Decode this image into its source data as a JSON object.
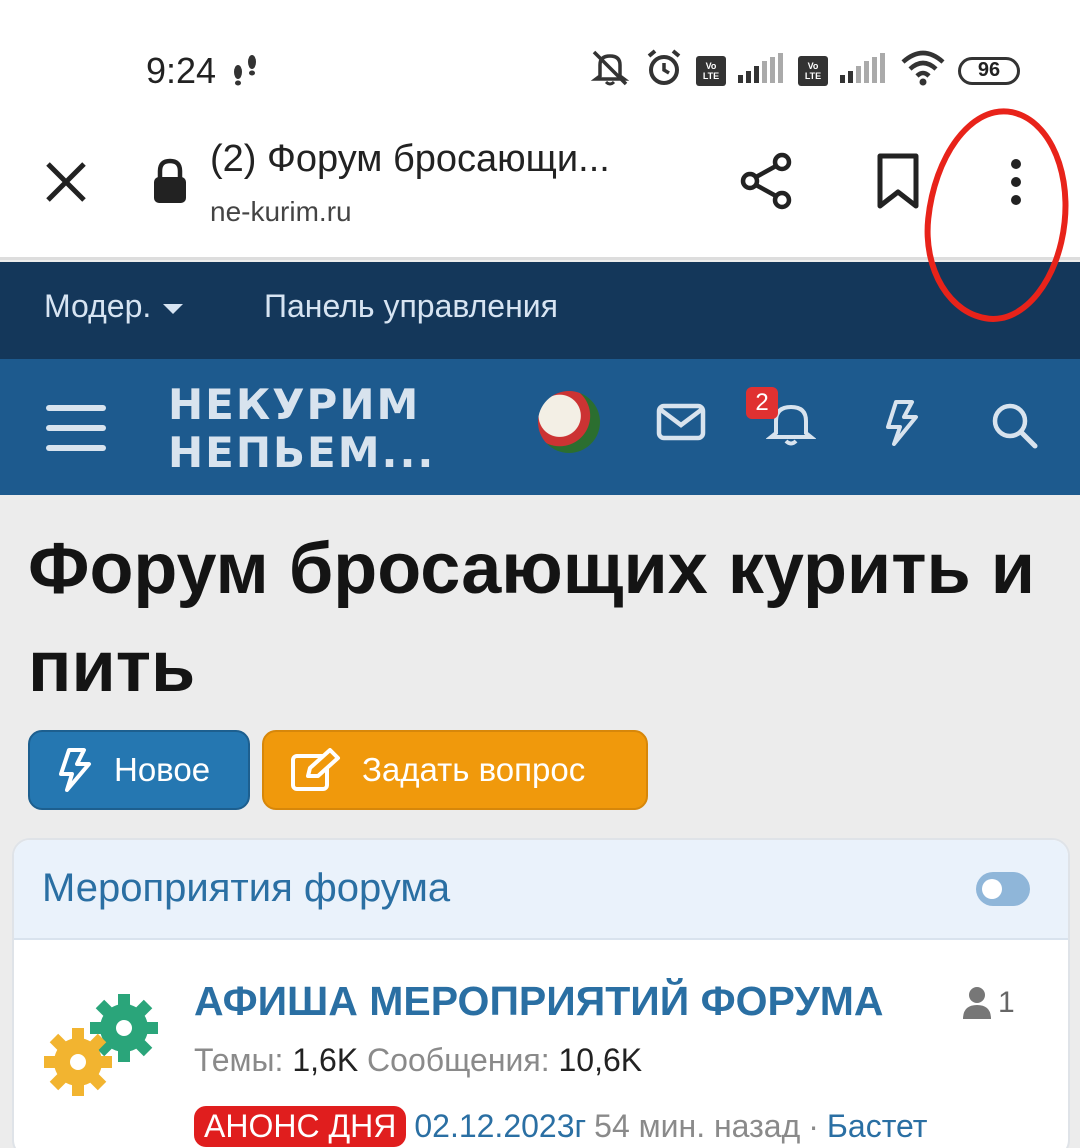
{
  "status_bar": {
    "time": "9:24",
    "battery": "96",
    "volte": "Vo LTE"
  },
  "browser": {
    "title": "(2) Форум бросающи...",
    "url": "ne-kurim.ru"
  },
  "mod_bar": {
    "moder_label": "Модер.",
    "panel_label": "Панель управления"
  },
  "header": {
    "logo_line1": "НЕКУРИМ",
    "logo_line2": "НЕПЬЕМ...",
    "notification_count": "2"
  },
  "main": {
    "title": "Форум бросающих курить и пить",
    "new_button": "Новое",
    "ask_button": "Задать вопрос"
  },
  "block": {
    "title": "Мероприятия форума",
    "node": {
      "title": "АФИША МЕРОПРИЯТИЙ ФОРУМА",
      "users": "1",
      "threads_label": "Темы:",
      "threads_value": "1,6K",
      "messages_label": "Сообщения:",
      "messages_value": "10,6K",
      "last_badge": "АНОНС ДНЯ",
      "last_title": "02.12.2023г",
      "last_time": "54 мин. назад",
      "separator": "·",
      "last_user": "Бастет"
    }
  },
  "colors": {
    "mod_bar": "#14375a",
    "header": "#1d5a8e",
    "accent_blue": "#2577b1",
    "accent_orange": "#f0990c",
    "annotation_red": "#e8231a"
  }
}
